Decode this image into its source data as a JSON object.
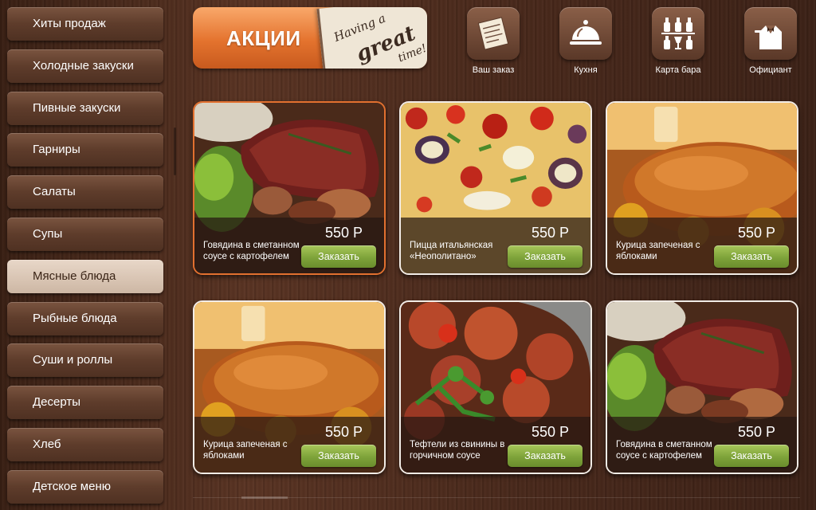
{
  "sidebar": {
    "items": [
      {
        "label": "Хиты продаж"
      },
      {
        "label": "Холодные закуски"
      },
      {
        "label": "Пивные закуски"
      },
      {
        "label": "Гарниры"
      },
      {
        "label": "Салаты"
      },
      {
        "label": "Супы"
      },
      {
        "label": "Мясные блюда"
      },
      {
        "label": "Рыбные блюда"
      },
      {
        "label": "Суши и роллы"
      },
      {
        "label": "Десерты"
      },
      {
        "label": "Хлеб"
      },
      {
        "label": "Детское меню"
      }
    ],
    "active_index": 6
  },
  "promo": {
    "title": "АКЦИИ",
    "sign_lines": [
      "Having a",
      "great",
      "time!"
    ]
  },
  "top_nav": [
    {
      "label": "Ваш заказ",
      "icon": "order-note-icon"
    },
    {
      "label": "Кухня",
      "icon": "cloche-icon"
    },
    {
      "label": "Карта бара",
      "icon": "bottles-icon"
    },
    {
      "label": "Официант",
      "icon": "waiter-icon"
    }
  ],
  "products": [
    {
      "name": "Говядина в сметанном соусе с картофелем",
      "price": "550 Р",
      "order_label": "Заказать",
      "image": "beef-steak-image",
      "selected": true
    },
    {
      "name": "Пицца итальянская «Неополитано»",
      "price": "550 Р",
      "order_label": "Заказать",
      "image": "pizza-image"
    },
    {
      "name": "Курица запеченая с яблоками",
      "price": "550 Р",
      "order_label": "Заказать",
      "image": "roast-chicken-image"
    },
    {
      "name": "Курица запеченая с яблоками",
      "price": "550 Р",
      "order_label": "Заказать",
      "image": "roast-chicken-image"
    },
    {
      "name": "Тефтели из свинины в горчичном соусе",
      "price": "550 Р",
      "order_label": "Заказать",
      "image": "meatballs-image"
    },
    {
      "name": "Говядина в сметанном соусе с картофелем",
      "price": "550 Р",
      "order_label": "Заказать",
      "image": "beef-steak-image"
    }
  ],
  "colors": {
    "accent_orange": "#e4732e",
    "order_green": "#7ea33a",
    "wood_dark": "#3a2014"
  }
}
